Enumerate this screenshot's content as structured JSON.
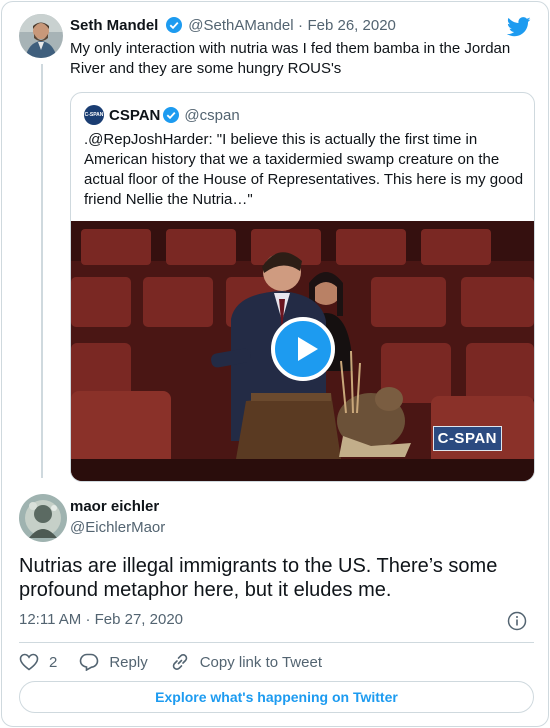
{
  "tweet": {
    "author": {
      "name": "Seth Mandel",
      "handle": "@SethAMandel",
      "date": "Feb 26, 2020",
      "verified": true
    },
    "text": "My only interaction with nutria was I fed them bamba in the Jordan River and they are some hungry ROUS's"
  },
  "quote": {
    "author": {
      "name": "CSPAN",
      "handle": "@cspan",
      "verified": true,
      "avatar_text": "C-SPAN"
    },
    "text": ".@RepJoshHarder: \"I believe this is actually the first time in American history that we a taxidermied swamp creature on the actual floor of the House of Representatives. This here is my good friend Nellie the Nutria…\"",
    "video": {
      "watermark": "C-SPAN"
    }
  },
  "reply": {
    "author": {
      "name": "maor eichler",
      "handle": "@EichlerMaor"
    },
    "text": "Nutrias are illegal immigrants to the US. There’s some profound metaphor here, but it eludes me.",
    "time": "12:11 AM",
    "date": "Feb 27, 2020",
    "date_separator": "·"
  },
  "actions": {
    "likes": "2",
    "reply_label": "Reply",
    "copy_link_label": "Copy link to Tweet"
  },
  "explore_label": "Explore what's happening on Twitter",
  "colors": {
    "accent": "#1d9bf0",
    "text": "#0f1419",
    "muted": "#536471",
    "border": "#cfd9de"
  }
}
